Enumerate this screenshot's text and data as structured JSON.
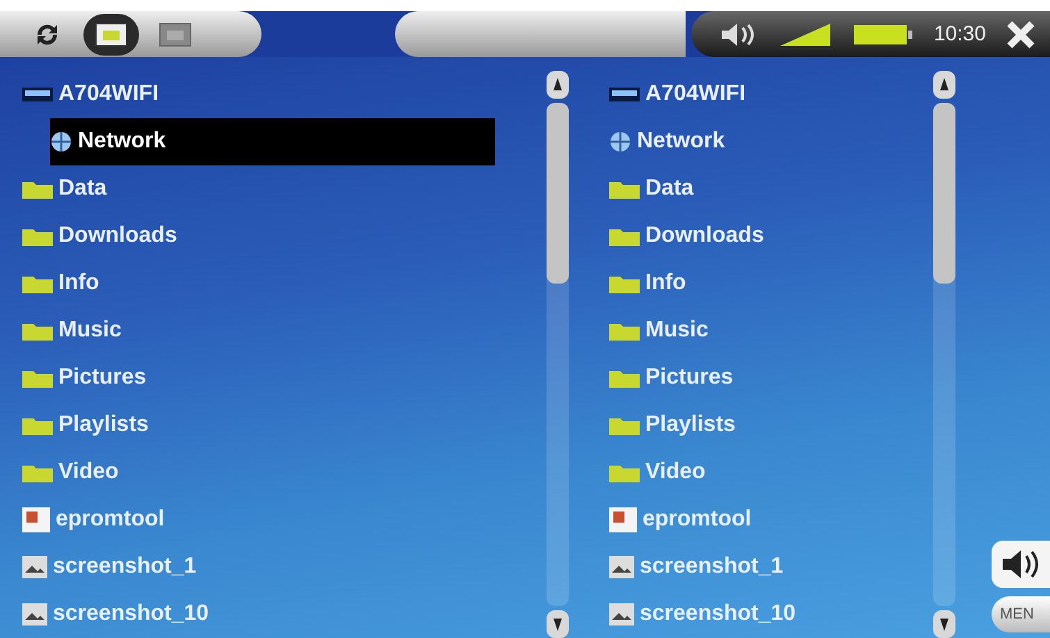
{
  "toolbar": {
    "tabs": [
      {
        "kind": "refresh",
        "selected": false
      },
      {
        "kind": "browser",
        "selected": true
      },
      {
        "kind": "other",
        "selected": false
      }
    ]
  },
  "status": {
    "time": "10:30"
  },
  "panes": [
    {
      "items": [
        {
          "kind": "drive",
          "label": "A704WIFI",
          "selected": false
        },
        {
          "kind": "network",
          "label": "Network",
          "selected": true
        },
        {
          "kind": "folder",
          "label": "Data",
          "selected": false
        },
        {
          "kind": "folder",
          "label": "Downloads",
          "selected": false
        },
        {
          "kind": "folder",
          "label": "Info",
          "selected": false
        },
        {
          "kind": "folder",
          "label": "Music",
          "selected": false
        },
        {
          "kind": "folder",
          "label": "Pictures",
          "selected": false
        },
        {
          "kind": "folder",
          "label": "Playlists",
          "selected": false
        },
        {
          "kind": "folder",
          "label": "Video",
          "selected": false
        },
        {
          "kind": "app",
          "label": "epromtool",
          "selected": false
        },
        {
          "kind": "image",
          "label": "screenshot_1",
          "selected": false
        },
        {
          "kind": "image",
          "label": "screenshot_10",
          "selected": false
        }
      ]
    },
    {
      "items": [
        {
          "kind": "drive",
          "label": "A704WIFI",
          "selected": false
        },
        {
          "kind": "network",
          "label": "Network",
          "selected": false
        },
        {
          "kind": "folder",
          "label": "Data",
          "selected": false
        },
        {
          "kind": "folder",
          "label": "Downloads",
          "selected": false
        },
        {
          "kind": "folder",
          "label": "Info",
          "selected": false
        },
        {
          "kind": "folder",
          "label": "Music",
          "selected": false
        },
        {
          "kind": "folder",
          "label": "Pictures",
          "selected": false
        },
        {
          "kind": "folder",
          "label": "Playlists",
          "selected": false
        },
        {
          "kind": "folder",
          "label": "Video",
          "selected": false
        },
        {
          "kind": "app",
          "label": "epromtool",
          "selected": false
        },
        {
          "kind": "image",
          "label": "screenshot_1",
          "selected": false
        },
        {
          "kind": "image",
          "label": "screenshot_10",
          "selected": false
        }
      ]
    }
  ],
  "side": {
    "menu_label": "MEN"
  }
}
